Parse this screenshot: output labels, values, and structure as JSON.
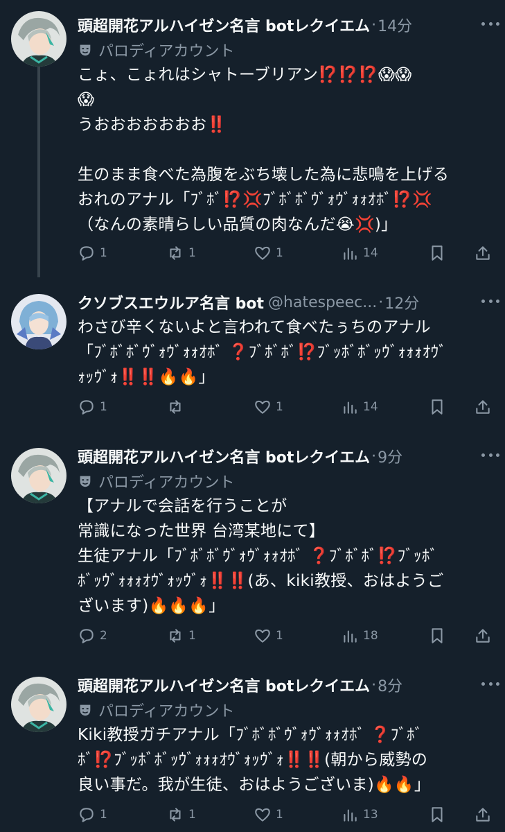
{
  "tweets": [
    {
      "name": "頭超開花アルハイゼン名言 botレクイエム",
      "handle": "",
      "sep": "·",
      "time": "14分",
      "parody_label": "パロディアカウント",
      "text": "こょ、こょれはシャトーブリアン⁉️⁉️⁉️😱😱\n😱\nうおおおおおおお‼️\n\n生のまま食べた為腹をぶち壊した為に悲鳴を上げる\nおれのアナル「ﾌﾞﾎﾞ⁉️💢ﾌﾞﾎﾞﾎﾞｳﾞｫｳﾞｫｫｵﾎﾞ⁉️💢\n（なんの素晴らしい品質の肉なんだ😭💢)」",
      "replies": "1",
      "retweets": "1",
      "likes": "1",
      "views": "14"
    },
    {
      "name": "クソブスエウルア名言 bot",
      "handle": "@hatespeec...",
      "sep": "·",
      "time": "12分",
      "parody_label": "",
      "text": "わさび辛くないよと言われて食べたぅちのアナル\n「ﾌﾞﾎﾞﾎﾞｳﾞｫｳﾞｫｫｵﾎﾞ ❓ﾌﾞﾎﾞﾎﾞ⁉️ﾌﾞｯﾎﾞﾎﾞｯｳﾞｫｫｫｵｳﾞ\nｫｯｳﾞｫ‼️‼️🔥🔥」",
      "replies": "1",
      "retweets": "",
      "likes": "1",
      "views": "14"
    },
    {
      "name": "頭超開花アルハイゼン名言 botレクイエム",
      "handle": "",
      "sep": "·",
      "time": "9分",
      "parody_label": "パロディアカウント",
      "text": "【アナルで会話を行うことが\n常識になった世界 台湾某地にて】\n生徒アナル「ﾌﾞﾎﾞﾎﾞｳﾞｫｳﾞｫｫｵﾎﾞ ❓ﾌﾞﾎﾞﾎﾞ⁉️ﾌﾞｯﾎﾞ\nﾎﾞｯｳﾞｫｫｫｵｳﾞｫｯｳﾞｫ‼️‼️(あ、kiki教授、おはようご\nざいます)🔥🔥🔥」",
      "replies": "2",
      "retweets": "1",
      "likes": "1",
      "views": "18"
    },
    {
      "name": "頭超開花アルハイゼン名言 botレクイエム",
      "handle": "",
      "sep": "·",
      "time": "8分",
      "parody_label": "パロディアカウント",
      "text": "Kiki教授ガチアナル「ﾌﾞﾎﾞﾎﾞｳﾞｫｳﾞｫｫｵﾎﾞ ❓ﾌﾞﾎﾞ\nﾎﾞ⁉️ﾌﾞｯﾎﾞﾎﾞｯｳﾞｫｫｫｵｳﾞｫｯｳﾞｫ‼️‼️(朝から威勢の\n良い事だ。我が生徒、おはようございま)🔥🔥」",
      "replies": "1",
      "retweets": "1",
      "likes": "1",
      "views": "13"
    }
  ],
  "colors": {
    "background": "#15202b",
    "text": "#f7f9f9",
    "secondary": "#8b98a5",
    "thread_line": "#38444d"
  }
}
